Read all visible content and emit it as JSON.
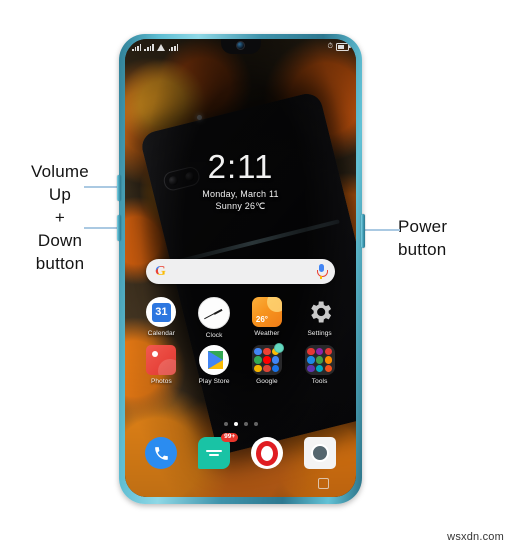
{
  "annotations": {
    "left_label": "Volume\nUp\n+\nDown\nbutton",
    "right_label": "Power\nbutton",
    "arrow_color": "#aac9e2"
  },
  "phone": {
    "frame_color": "#3f93ab",
    "hardware_keys": [
      {
        "name": "volume-up-key",
        "label": "Volume Up"
      },
      {
        "name": "volume-down-key",
        "label": "Volume Down"
      },
      {
        "name": "power-key",
        "label": "Power"
      }
    ],
    "statusbar": {
      "left_icons": [
        "signal-bars-icon",
        "signal-bars-icon",
        "wifi-icon",
        "sim-signal-icon"
      ],
      "right_icons": [
        "alarm-icon",
        "battery-icon"
      ],
      "battery_text": ""
    },
    "notch": {
      "camera": "front-camera-icon"
    },
    "clock_widget": {
      "time": "2:11",
      "date": "Monday, March 11",
      "weather": "Sunny 26℃"
    },
    "search": {
      "logo": "google-g-icon",
      "placeholder": "",
      "value": "",
      "mic": "microphone-icon"
    },
    "app_rows": [
      [
        {
          "label": "Calendar",
          "icon": "calendar-icon",
          "badge": "31"
        },
        {
          "label": "Clock",
          "icon": "clock-icon",
          "badge": ""
        },
        {
          "label": "Weather",
          "icon": "weather-icon",
          "badge": "26°"
        },
        {
          "label": "Settings",
          "icon": "gear-icon",
          "badge": ""
        }
      ],
      [
        {
          "label": "Photos",
          "icon": "photos-icon",
          "badge": ""
        },
        {
          "label": "Play Store",
          "icon": "play-store-icon",
          "badge": ""
        },
        {
          "label": "Google",
          "icon": "folder-icon",
          "badge": ""
        },
        {
          "label": "Tools",
          "icon": "folder-icon",
          "badge": ""
        }
      ]
    ],
    "page_dots": {
      "count": 4,
      "active_index": 1
    },
    "dock": [
      {
        "label": "Phone",
        "icon": "phone-icon",
        "badge": ""
      },
      {
        "label": "Messages",
        "icon": "message-icon",
        "badge": "99+"
      },
      {
        "label": "Opera",
        "icon": "opera-icon",
        "badge": ""
      },
      {
        "label": "Camera",
        "icon": "camera-icon",
        "badge": ""
      }
    ],
    "home_indicator": "home-square-icon"
  },
  "watermark": "wsxdn.com"
}
